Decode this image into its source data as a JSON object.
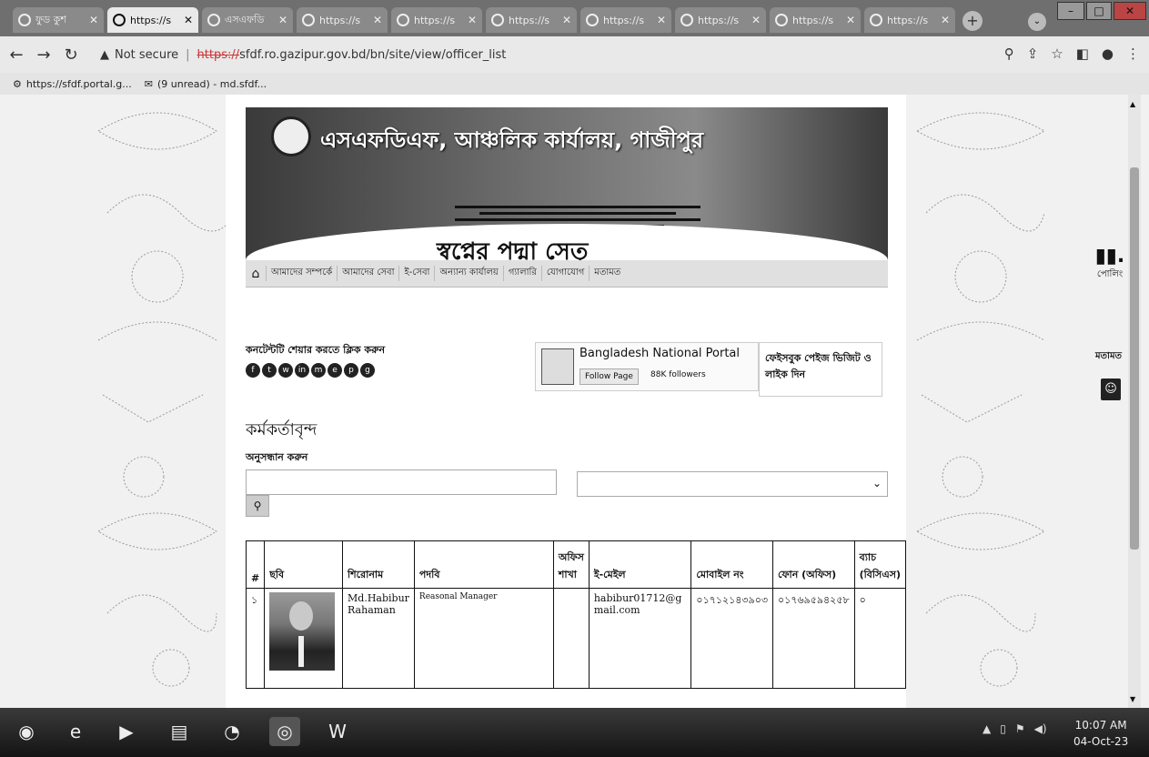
{
  "browser": {
    "tabs": [
      {
        "label": "ফুড কুশ",
        "active": false
      },
      {
        "label": "https://s",
        "active": true
      },
      {
        "label": "এসএফডি",
        "active": false
      },
      {
        "label": "https://s",
        "active": false
      },
      {
        "label": "https://s",
        "active": false
      },
      {
        "label": "https://s",
        "active": false
      },
      {
        "label": "https://s",
        "active": false
      },
      {
        "label": "https://s",
        "active": false
      },
      {
        "label": "https://s",
        "active": false
      },
      {
        "label": "https://s",
        "active": false
      }
    ],
    "security_label": "Not secure",
    "url_scheme": "https://",
    "url_rest": "sfdf.ro.gazipur.gov.bd/bn/site/view/officer_list",
    "bookmarks": [
      {
        "label": "https://sfdf.portal.g..."
      },
      {
        "label": "(9 unread) - md.sfdf..."
      }
    ]
  },
  "site": {
    "title": "এসএফডিএফ, আঞ্চলিক কার্যালয়, গাজীপুর",
    "slogan": "স্বপ্নের পদ্মা সেতু",
    "menu": [
      "আমাদের সম্পর্কে",
      "আমাদের সেবা",
      "ই-সেবা",
      "অন্যান্য কার্যালয়",
      "গ্যালারি",
      "যোগাযোগ",
      "মতামত"
    ],
    "share_label": "কনটেন্টটি শেয়ার করতে ক্লিক করুন",
    "share_icons": [
      "f",
      "t",
      "w",
      "in",
      "m",
      "e",
      "p",
      "g"
    ],
    "fb_page_name": "Bangladesh National Portal",
    "fb_follow": "Follow Page",
    "fb_followers": "88K followers",
    "fb_visit": "ফেইসবুক পেইজ ভিজিট ও লাইক দিন",
    "heading": "কর্মকর্তাবৃন্দ",
    "search_label": "অনুসন্ধান করুন",
    "search_value": "",
    "select_value": "",
    "table": {
      "headers": [
        "#",
        "ছবি",
        "শিরোনাম",
        "পদবি",
        "অফিস শাখা",
        "ই-মেইল",
        "মোবাইল নং",
        "ফোন (অফিস)",
        "ব্যাচ (বিসিএস)"
      ],
      "rows": [
        {
          "idx": "১",
          "name": "Md.Habibur Rahaman",
          "designation": "Reasonal Manager",
          "branch": "",
          "email": "habibur01712@gmail.com",
          "mobile": "০১৭১২১৪৩৯০৩",
          "phone": "০১৭৬৯৫৯৪২৫৮",
          "batch": "০"
        }
      ]
    }
  },
  "side": {
    "poling_label": "পোলিং",
    "motamot_label": "মতামত"
  },
  "taskbar": {
    "time": "10:07 AM",
    "date": "04-Oct-23"
  }
}
